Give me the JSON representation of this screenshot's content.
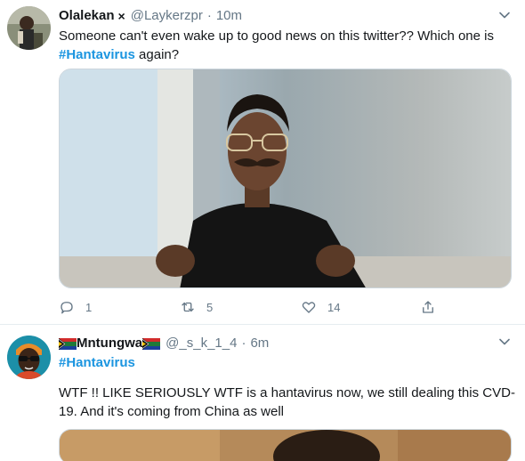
{
  "tweets": [
    {
      "display_name": "Olalekan",
      "name_suffix": "×",
      "handle": "@Laykerzpr",
      "separator": "·",
      "time": "10m",
      "text_before": "Someone can't  even wake up to good news on this twitter?? Which one is",
      "hashtag": "#Hantavirus",
      "text_after": " again?",
      "avatar_icon": "person-avatar-icon",
      "media_description_icon": "video-still-icon",
      "actions": {
        "reply_count": "1",
        "retweet_count": "5",
        "like_count": "14"
      }
    },
    {
      "display_name": "Mntungwa",
      "handle": "@_s_k_1_4",
      "separator": "·",
      "time": "6m",
      "hashtag": "#Hantavirus",
      "text": "WTF !! LIKE SERIOUSLY WTF is a hantavirus now, we still dealing this CVD-19. And it's coming from China as well",
      "avatar_icon": "person-avatar-icon",
      "flag_icon": "south-africa-flag-icon"
    }
  ],
  "colors": {
    "hashtag": "#1b95e0",
    "secondary_text": "#657786",
    "primary_text": "#14171a",
    "border": "#e6ecf0"
  }
}
